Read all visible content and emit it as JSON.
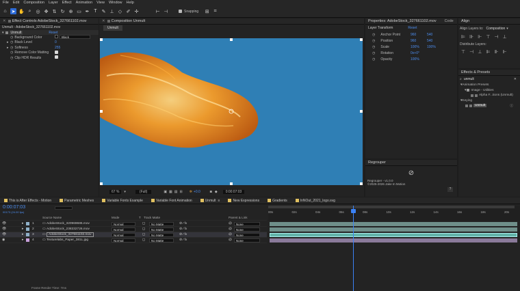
{
  "menu": [
    "File",
    "Edit",
    "Composition",
    "Layer",
    "Effect",
    "Animation",
    "View",
    "Window",
    "Help"
  ],
  "toolbar": {
    "snapping": "Snapping"
  },
  "effect_controls": {
    "tab": "Effect Controls AdobeStock_327661102.mov",
    "path": "Unmult - AdobeStock_327661102.mov",
    "effect_name": "Unmult",
    "reset": "Reset",
    "rows": [
      {
        "label": "Background Color",
        "value": "Black"
      },
      {
        "label": "Black Level",
        "value": "0"
      },
      {
        "label": "Softness",
        "value": "255"
      },
      {
        "label": "Remove Color Matting",
        "value": ""
      },
      {
        "label": "Clip HDR Results",
        "value": ""
      }
    ]
  },
  "composition": {
    "tab": "Composition Unmult",
    "crumb": "Unmult",
    "zoom": "67 %",
    "quality": "(Full)",
    "exposure": "+0.0",
    "timecode": "0:00:07:03"
  },
  "properties": {
    "tab": "Properties: AdobeStock_327661102.mov",
    "tab2": "Code",
    "section": "Layer Transform",
    "reset": "Reset",
    "rows": [
      {
        "label": "Anchor Point",
        "v1": "960",
        "v2": "540"
      },
      {
        "label": "Position",
        "v1": "960",
        "v2": "540"
      },
      {
        "label": "Scale",
        "v1": "100%",
        "v2": "100%"
      },
      {
        "label": "Rotation",
        "v1": "0x+0°",
        "v2": ""
      },
      {
        "label": "Opacity",
        "v1": "100%",
        "v2": ""
      }
    ]
  },
  "regrouper": {
    "title": "Regrouper",
    "version": "Regrouper - v1.0.0",
    "copyright": "©2025-2026 Jake In Motion"
  },
  "align": {
    "title": "Align",
    "align_to_label": "Align Layers to:",
    "align_to_value": "Composition",
    "distribute": "Distribute Layers:"
  },
  "effects_presets": {
    "title": "Effects & Presets",
    "search": "unmult",
    "tree": [
      "Animation Presets",
      "Image - Utilities",
      "Alpha F...tions (Unmult)",
      "Keying",
      "Unmult"
    ]
  },
  "timeline": {
    "tabs": [
      "This is After Effects - Motion",
      "Parametric Meshes",
      "Variable Fonts Example",
      "Variable Font Animation",
      "Unmult",
      "New Expressions",
      "Gradients",
      "InNOut_2021_logo.svg"
    ],
    "timecode": "0:00:07:03",
    "frame_rate": "00173 (24.00 fps)",
    "headers": {
      "source": "Source Name",
      "mode": "Mode",
      "t": "T",
      "track": "Track Matte",
      "parent": "Parent & Link"
    },
    "layers": [
      {
        "num": "1",
        "name": "AdobeStock_320969686.mov",
        "mode": "Normal",
        "matte": "No Matte",
        "parent": "None",
        "color": "#8fb0c8"
      },
      {
        "num": "2",
        "name": "AdobeStock_238332726.mov",
        "mode": "Normal",
        "matte": "No Matte",
        "parent": "None",
        "color": "#8fb0c8"
      },
      {
        "num": "3",
        "name": "AdobeStock_327661102.mov",
        "mode": "Normal",
        "matte": "No Matte",
        "parent": "None",
        "color": "#8fb0c8"
      },
      {
        "num": "4",
        "name": "Texturelabs_Paper_381L.jpg",
        "mode": "Normal",
        "matte": "No Matte",
        "parent": "None",
        "color": "#c9a0dc"
      }
    ],
    "ruler": [
      "00s",
      "02s",
      "04s",
      "06s",
      "08s",
      "10s",
      "12s",
      "14s",
      "16s",
      "18s",
      "20s"
    ],
    "status": "Frame Render Time: 7ms"
  },
  "colors": {
    "accent": "#2d6bd8",
    "comp_bg": "#2f7fb5",
    "fire": "#f08a1a",
    "bar": "#5fa8a0",
    "playhead": "#3b82f6"
  }
}
